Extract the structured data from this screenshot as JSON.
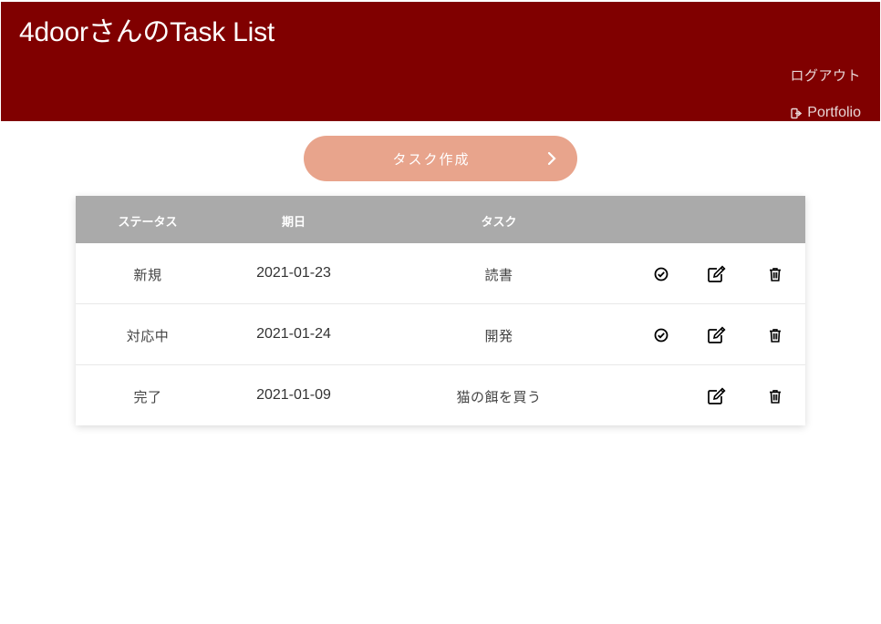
{
  "header": {
    "title": "4doorさんのTask List",
    "logout_label": "ログアウト",
    "portfolio_label": "Portfolio",
    "background": "#800000"
  },
  "create_button": {
    "label": "タスク作成",
    "color": "#e8a48c"
  },
  "table": {
    "columns": [
      "ステータス",
      "期日",
      "タスク"
    ],
    "rows": [
      {
        "status": "新規",
        "date": "2021-01-23",
        "task": "読書",
        "complete_icon": true
      },
      {
        "status": "対応中",
        "date": "2021-01-24",
        "task": "開発",
        "complete_icon": true
      },
      {
        "status": "完了",
        "date": "2021-01-09",
        "task": "猫の餌を買う",
        "complete_icon": false
      }
    ],
    "header_color": "#aaaaaa"
  },
  "icons": {
    "complete": "check-circle-icon",
    "edit": "edit-icon",
    "delete": "trash-icon",
    "portfolio": "sign-out-icon",
    "create_chevron": "chevron-right-icon"
  }
}
